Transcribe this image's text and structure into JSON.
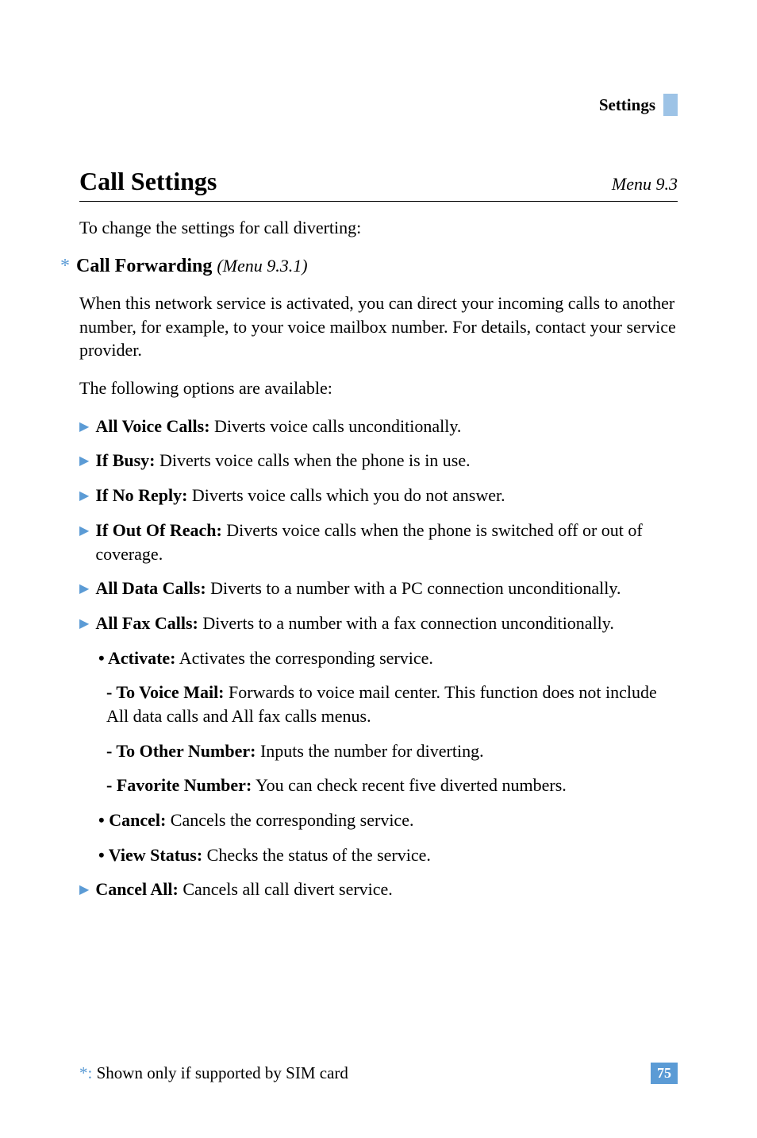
{
  "header": {
    "label": "Settings"
  },
  "section": {
    "title": "Call Settings",
    "menu": "Menu 9.3",
    "intro": "To change the settings for call diverting:"
  },
  "subsection": {
    "title": "Call Forwarding",
    "menu": "(Menu 9.3.1)",
    "para1": "When this network service is activated, you can direct your incoming calls to another number, for example, to your voice mailbox number. For details, contact your service provider.",
    "para2": "The following options are available:"
  },
  "items": [
    {
      "label": "All Voice Calls:",
      "text": " Diverts voice calls unconditionally."
    },
    {
      "label": "If Busy:",
      "text": " Diverts voice calls when the phone is in use."
    },
    {
      "label": "If No Reply:",
      "text": " Diverts voice calls which you do not answer."
    },
    {
      "label": "If Out Of Reach:",
      "text": " Diverts voice calls when the phone is switched off or out of coverage."
    },
    {
      "label": "All Data Calls:",
      "text": " Diverts to a number with a PC connection unconditionally."
    },
    {
      "label": "All Fax Calls:",
      "text": " Diverts to a number with a fax connection unconditionally."
    }
  ],
  "sub_items": {
    "activate_label": "• Activate:",
    "activate_text": " Activates the corresponding service.",
    "to_voice_label": "- To Voice Mail:",
    "to_voice_text": " Forwards to voice mail center. This function does not include All data calls and All fax calls menus.",
    "to_other_label": "- To Other Number:",
    "to_other_text": " Inputs the number for diverting.",
    "favorite_label": "- Favorite Number:",
    "favorite_text": " You can check recent five diverted numbers.",
    "cancel_label": "• Cancel:",
    "cancel_text": " Cancels the corresponding service.",
    "view_label": "• View Status:",
    "view_text": " Checks the status of the service."
  },
  "cancel_all": {
    "label": "Cancel All:",
    "text": " Cancels all call divert service."
  },
  "footer": {
    "asterisk": "*:",
    "note": " Shown only if supported by SIM card",
    "page": "75"
  }
}
